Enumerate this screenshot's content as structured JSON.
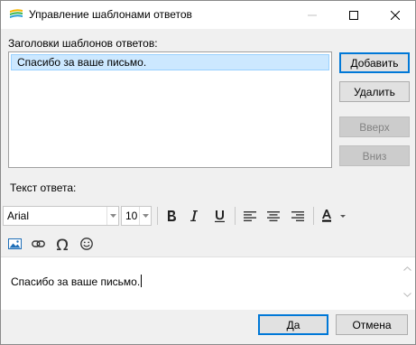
{
  "window": {
    "title": "Управление шаблонами ответов"
  },
  "templates": {
    "label": "Заголовки шаблонов ответов:",
    "items": [
      "Спасибо за ваше письмо."
    ],
    "selected_index": 0
  },
  "buttons": {
    "add": "Добавить",
    "delete": "Удалить",
    "up": "Вверх",
    "down": "Вниз",
    "ok": "Да",
    "cancel": "Отмена"
  },
  "reply": {
    "label": "Текст ответа:",
    "font_name": "Arial",
    "font_size": "10",
    "body": "Спасибо за ваше письмо."
  },
  "colors": {
    "selection": "#cce8ff",
    "focus_border": "#0078d7",
    "text_color_underline": "#000000"
  },
  "icons": {
    "app": "app-logo-icon",
    "minimize": "minimize-icon",
    "maximize": "maximize-icon",
    "close": "close-icon",
    "bold": "bold-icon",
    "italic": "italic-icon",
    "underline": "underline-icon",
    "align_left": "align-left-icon",
    "align_center": "align-center-icon",
    "align_right": "align-right-icon",
    "text_color": "text-color-icon",
    "image": "image-icon",
    "link": "link-icon",
    "special_char": "special-character-icon",
    "emoji": "emoji-icon"
  }
}
